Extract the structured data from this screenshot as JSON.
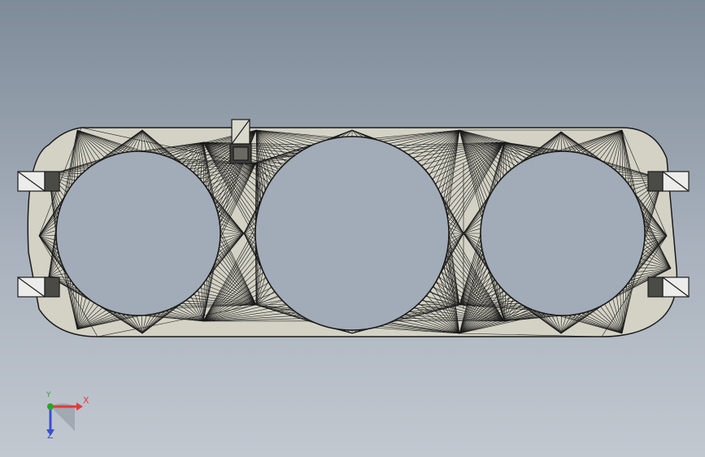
{
  "viewport": {
    "background_top": "#7e8b99",
    "background_bottom": "#c2c8d0"
  },
  "part": {
    "shape": "gauge-pod-panel",
    "hole_count": 3,
    "face_color": "#d2d1c4",
    "edge_color": "#1a1a1a",
    "shading": "triangulated-mesh"
  },
  "triad": {
    "x_label": "X",
    "y_label": "Y",
    "z_label": "Z",
    "x_color": "#e23a3a",
    "y_color": "#2aa52a",
    "z_color": "#3a4fd6"
  }
}
